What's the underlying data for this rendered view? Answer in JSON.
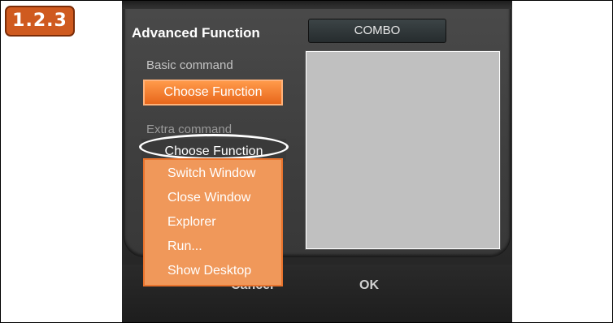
{
  "step_badge": "1.2.3",
  "dialog": {
    "title": "Advanced Function",
    "combo_label": "COMBO",
    "basic_command_label": "Basic command",
    "basic_choose_label": "Choose Function",
    "extra_command_label": "Extra command",
    "extra_choose_label": "Choose Function",
    "dropdown_items": [
      "Switch Window",
      "Close Window",
      "Explorer",
      "Run...",
      "Show Desktop"
    ],
    "cancel_label": "Cancel",
    "ok_label": "OK"
  },
  "colors": {
    "badge": "#cf5a1f",
    "accent_orange": "#e8671c",
    "dropdown_bg": "#f0985a",
    "dialog_bg": "#3e3e3e",
    "preview_bg": "#c0c0c0"
  }
}
